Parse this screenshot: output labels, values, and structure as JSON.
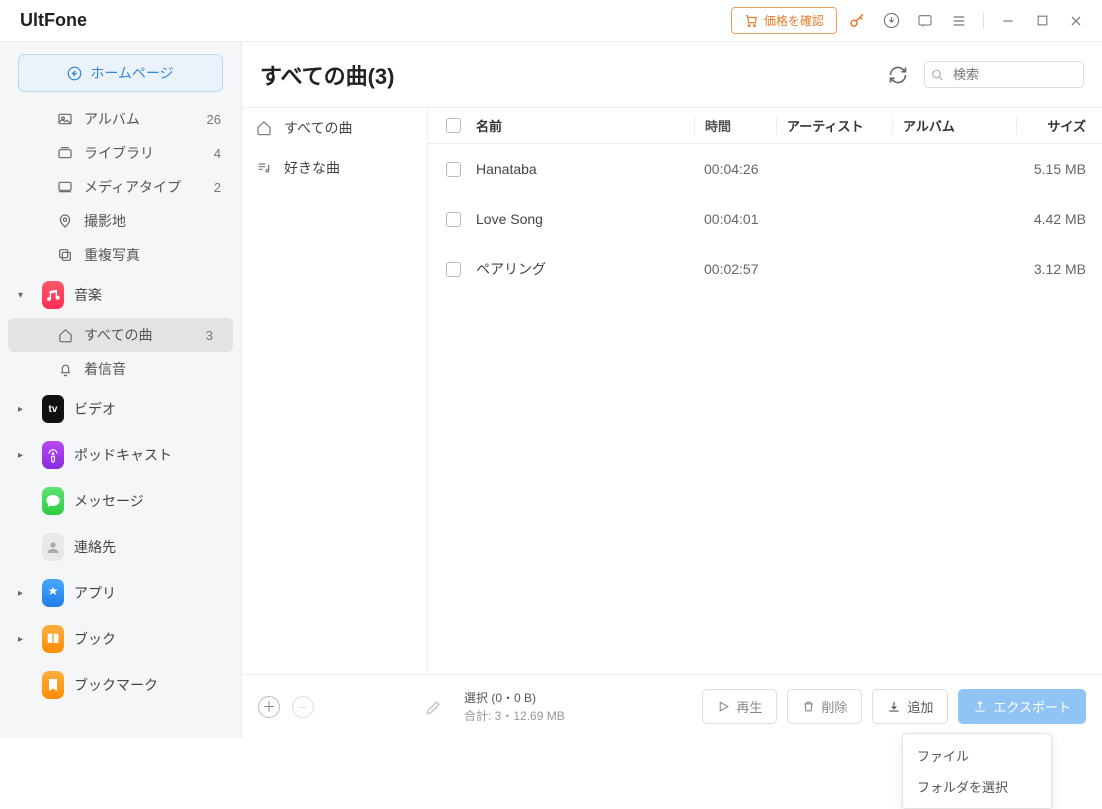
{
  "brand": "UltFone",
  "titlebar": {
    "price_label": "価格を確認"
  },
  "home_label": "ホームページ",
  "page_title": "すべての曲(3)",
  "search": {
    "placeholder": "検索"
  },
  "sidebar": {
    "items": [
      {
        "label": "アルバム",
        "count": "26"
      },
      {
        "label": "ライブラリ",
        "count": "4"
      },
      {
        "label": "メディアタイプ",
        "count": "2"
      },
      {
        "label": "撮影地",
        "count": ""
      },
      {
        "label": "重複写真",
        "count": ""
      }
    ],
    "music_label": "音楽",
    "music_sub": [
      {
        "label": "すべての曲",
        "count": "3"
      },
      {
        "label": "着信音",
        "count": ""
      }
    ],
    "cats": [
      {
        "label": "ビデオ"
      },
      {
        "label": "ポッドキャスト"
      },
      {
        "label": "メッセージ"
      },
      {
        "label": "連絡先"
      },
      {
        "label": "アプリ"
      },
      {
        "label": "ブック"
      },
      {
        "label": "ブックマーク"
      }
    ]
  },
  "midcol": {
    "items": [
      {
        "label": "すべての曲"
      },
      {
        "label": "好きな曲"
      }
    ]
  },
  "columns": {
    "name": "名前",
    "time": "時間",
    "artist": "アーティスト",
    "album": "アルバム",
    "size": "サイズ"
  },
  "tracks": [
    {
      "name": "Hanataba",
      "time": "00:04:26",
      "artist": "",
      "album": "",
      "size": "5.15 MB"
    },
    {
      "name": "Love Song",
      "time": "00:04:01",
      "artist": "",
      "album": "",
      "size": "4.42 MB"
    },
    {
      "name": "ペアリング",
      "time": "00:02:57",
      "artist": "",
      "album": "",
      "size": "3.12 MB"
    }
  ],
  "footer": {
    "selection": "選択 (0・0 B)",
    "total": "合計: 3・12.69 MB",
    "play": "再生",
    "delete": "削除",
    "add": "追加",
    "export": "エクスポート",
    "popup": {
      "file": "ファイル",
      "folder": "フォルダを選択"
    }
  }
}
